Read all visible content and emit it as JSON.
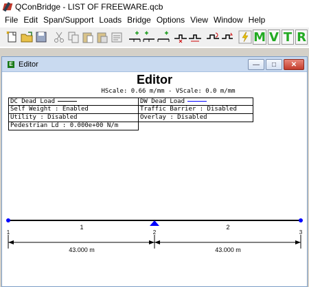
{
  "window": {
    "title": "QConBridge - LIST OF FREEWARE.qcb"
  },
  "menu": [
    "File",
    "Edit",
    "Span/Support",
    "Loads",
    "Bridge",
    "Options",
    "View",
    "Window",
    "Help"
  ],
  "toolbar": {
    "letters": [
      "M",
      "V",
      "T",
      "R"
    ]
  },
  "editor": {
    "window_title": "Editor",
    "heading": "Editor",
    "scale": "HScale: 0.66 m/mm - VScale: 0.0 m/mm",
    "legend": [
      [
        "DC Dead Load",
        "DW Dead Load"
      ],
      [
        "Self Weight : Enabled",
        "Traffic Barrier : Disabled"
      ],
      [
        "Utility : Disabled",
        "Overlay : Disabled"
      ],
      [
        "Pedestrian Ld : 0.000e+00 N/m",
        ""
      ]
    ],
    "legend_colors": {
      "dc": "#000000",
      "dw": "#0000ff"
    }
  },
  "bridge": {
    "spans": [
      {
        "label": "1",
        "length": "43.000 m"
      },
      {
        "label": "2",
        "length": "43.000 m"
      }
    ],
    "supports": [
      "1",
      "2",
      "3"
    ]
  }
}
